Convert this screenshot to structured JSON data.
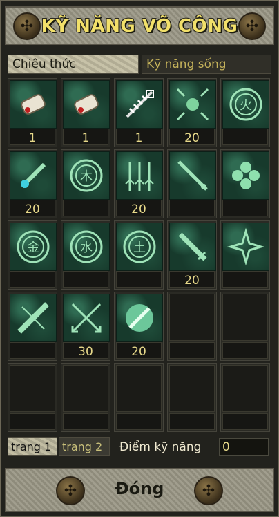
{
  "window": {
    "title": "KỸ NĂNG VÕ CÔNG"
  },
  "tabs": [
    {
      "label": "Chiêu thức",
      "active": true
    },
    {
      "label": "Kỹ năng sống",
      "active": false
    }
  ],
  "skills": [
    {
      "icon": "scroll-icon",
      "level": "1"
    },
    {
      "icon": "scroll-icon",
      "level": "1"
    },
    {
      "icon": "spiked-chain-icon",
      "level": "1"
    },
    {
      "icon": "burst-arrows-icon",
      "level": "20"
    },
    {
      "icon": "fire-rune-icon",
      "level": ""
    },
    {
      "icon": "glowing-sword-icon",
      "level": "20"
    },
    {
      "icon": "wood-rune-icon",
      "level": ""
    },
    {
      "icon": "triple-arrows-icon",
      "level": "20"
    },
    {
      "icon": "diagonal-blade-icon",
      "level": ""
    },
    {
      "icon": "clover-orbs-icon",
      "level": ""
    },
    {
      "icon": "metal-rune-icon",
      "level": ""
    },
    {
      "icon": "water-rune-icon",
      "level": ""
    },
    {
      "icon": "earth-rune-icon",
      "level": ""
    },
    {
      "icon": "broadsword-icon",
      "level": "20"
    },
    {
      "icon": "shuriken-icon",
      "level": ""
    },
    {
      "icon": "serrated-blade-icon",
      "level": ""
    },
    {
      "icon": "crossed-arrows-icon",
      "level": "30"
    },
    {
      "icon": "spinning-blade-icon",
      "level": "20"
    }
  ],
  "pagination": {
    "page1": "trang 1",
    "page2": "trang 2",
    "skill_points_label": "Điểm kỹ năng",
    "skill_points_value": "0"
  },
  "close": {
    "label": "Đóng"
  },
  "colors": {
    "gold_text": "#f2e06a",
    "level_text": "#e7d98a",
    "icon_jade": "#173a2c"
  }
}
